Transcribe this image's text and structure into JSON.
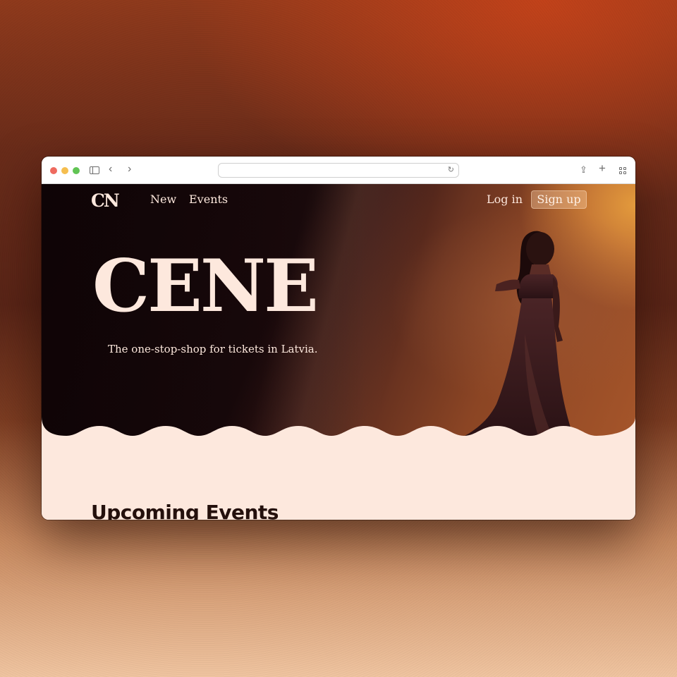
{
  "browser": {
    "address": "",
    "icons": {
      "sidebar": "sidebar-toggle-icon",
      "back": "chevron-left-icon",
      "forward": "chevron-right-icon",
      "reload": "reload-icon",
      "share": "share-icon",
      "new_tab": "plus-icon",
      "tab_overview": "tab-grid-icon"
    },
    "glyphs": {
      "back": "‹",
      "forward": "›",
      "reload": "↻",
      "share": "⇪",
      "new_tab": "+"
    },
    "colors": {
      "close": "#ee6a5f",
      "minimize": "#f5be4f",
      "maximize": "#61c454"
    }
  },
  "site": {
    "logo": "CN",
    "nav": {
      "new": "New",
      "events": "Events",
      "login": "Log in",
      "signup": "Sign up"
    },
    "hero": {
      "title": "CENE",
      "tagline": "The one-stop-shop for tickets in Latvia."
    },
    "sections": {
      "upcoming": "Upcoming Events"
    }
  },
  "colors": {
    "cream": "#fde8dd",
    "dark_text": "#24100c",
    "hero_dark": "#140608",
    "hero_orange": "#e39a3c"
  }
}
